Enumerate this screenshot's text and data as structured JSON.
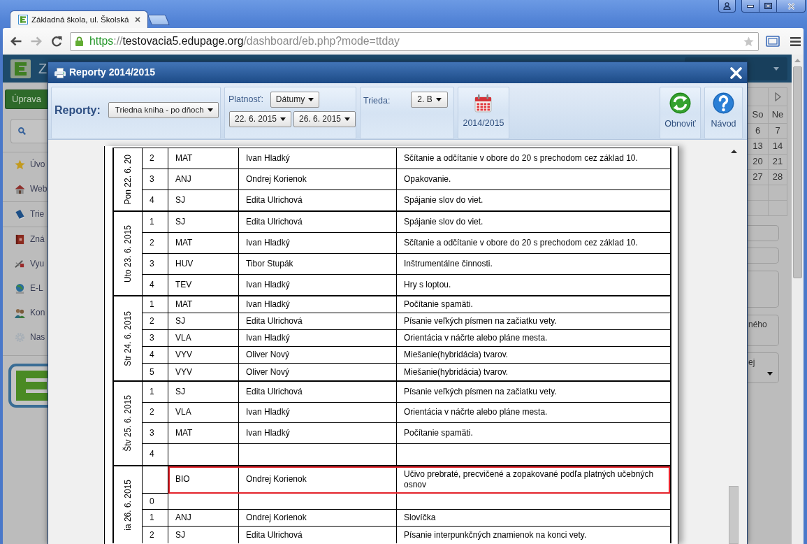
{
  "browser": {
    "tab": {
      "title": "Základná škola, ul. Školská"
    },
    "nav": [
      {
        "kind": "back",
        "disabled": false
      },
      {
        "kind": "forward",
        "disabled": true
      },
      {
        "kind": "reload",
        "disabled": false
      }
    ],
    "url": [
      {
        "text": "https",
        "kind": "scheme"
      },
      {
        "text": "://",
        "kind": "plain"
      },
      {
        "text": "testovacia5.edupage.org",
        "kind": "host"
      },
      {
        "text": "/dashboard/eb.php?mode=ttday",
        "kind": "plain"
      }
    ]
  },
  "background_page": {
    "header": {
      "title": "Z"
    },
    "edit_button": "Úprava",
    "sidebar": [
      {
        "label": "Úvo"
      },
      {
        "label": "Web"
      },
      {
        "label": "Trie"
      },
      {
        "label": "Zná"
      },
      {
        "label": "Vyu"
      },
      {
        "label": "E-L"
      },
      {
        "label": "Kon"
      },
      {
        "label": "Nas"
      }
    ],
    "calendar": {
      "weekdays": [
        "So",
        "Ne"
      ],
      "weeks": [
        [
          "6",
          "7"
        ],
        [
          "13",
          "14"
        ],
        [
          "20",
          "21"
        ],
        [
          "27",
          "28"
        ]
      ]
    },
    "side_panels": [
      {
        "text": "ného",
        "dropdown": false
      },
      {
        "text": "ej",
        "dropdown": true
      }
    ]
  },
  "dialog": {
    "title": "Reporty 2014/2015",
    "report": {
      "label": "Reporty:",
      "value": "Triedna kniha - po dňoch"
    },
    "validity": {
      "label": "Platnosť:",
      "mode": "Dátumy",
      "from": "22. 6. 2015",
      "to": "26. 6. 2015"
    },
    "class": {
      "label": "Trieda:",
      "value": "2. B"
    },
    "school_year": "2014/2015",
    "actions": [
      {
        "kind": "refresh",
        "label": "Obnoviť"
      },
      {
        "kind": "help",
        "label": "Návod"
      }
    ]
  },
  "report": {
    "days": [
      {
        "label": "Pon 22. 6. 20",
        "lessons": [
          {
            "number": "2",
            "subject": "MAT",
            "teacher": "Ivan Hladký",
            "topic": "Sčítanie a odčítanie v obore do 20 s prechodom cez základ 10.",
            "highlighted": false
          },
          {
            "number": "3",
            "subject": "ANJ",
            "teacher": "Ondrej Korienok",
            "topic": "Opakovanie.",
            "highlighted": false
          },
          {
            "number": "4",
            "subject": "SJ",
            "teacher": "Edita Ulrichová",
            "topic": "Spájanie slov do viet.",
            "highlighted": false
          }
        ]
      },
      {
        "label": "Uto 23. 6. 2015",
        "lessons": [
          {
            "number": "1",
            "subject": "SJ",
            "teacher": "Edita Ulrichová",
            "topic": "Spájanie slov do viet.",
            "highlighted": false
          },
          {
            "number": "2",
            "subject": "MAT",
            "teacher": "Ivan Hladký",
            "topic": "Sčítanie a odčítanie v obore do 20 s prechodom cez základ 10.",
            "highlighted": false
          },
          {
            "number": "3",
            "subject": "HUV",
            "teacher": "Tibor Stupák",
            "topic": "Inštrumentálne činnosti.",
            "highlighted": false
          },
          {
            "number": "4",
            "subject": "TEV",
            "teacher": "Ivan Hladký",
            "topic": "Hry s loptou.",
            "highlighted": false
          }
        ]
      },
      {
        "label": "Str 24. 6. 2015",
        "lessons": [
          {
            "number": "1",
            "subject": "MAT",
            "teacher": "Ivan Hladký",
            "topic": "Počítanie spamäti.",
            "highlighted": false
          },
          {
            "number": "2",
            "subject": "SJ",
            "teacher": "Edita Ulrichová",
            "topic": "Písanie veľkých písmen na začiatku vety.",
            "highlighted": false
          },
          {
            "number": "3",
            "subject": "VLA",
            "teacher": "Ivan Hladký",
            "topic": "Orientácia v náčrte alebo pláne mesta.",
            "highlighted": false
          },
          {
            "number": "4",
            "subject": "VYV",
            "teacher": "Oliver Nový",
            "topic": "Miešanie(hybridácia) tvarov.",
            "highlighted": false
          },
          {
            "number": "5",
            "subject": "VYV",
            "teacher": "Oliver Nový",
            "topic": "Miešanie(hybridácia) tvarov.",
            "highlighted": false
          }
        ]
      },
      {
        "label": "Štv 25. 6. 2015",
        "lessons": [
          {
            "number": "1",
            "subject": "SJ",
            "teacher": "Edita Ulrichová",
            "topic": "Písanie veľkých písmen na začiatku vety.",
            "highlighted": false
          },
          {
            "number": "2",
            "subject": "VLA",
            "teacher": "Ivan Hladký",
            "topic": "Orientácia v náčrte alebo pláne mesta.",
            "highlighted": false
          },
          {
            "number": "3",
            "subject": "MAT",
            "teacher": "Ivan Hladký",
            "topic": "Počítanie spamäti.",
            "highlighted": false
          },
          {
            "number": "4",
            "highlighted": false
          }
        ]
      },
      {
        "label": "ia 26. 6. 2015",
        "lessons": [
          {
            "subject": "BIO",
            "teacher": "Ondrej Korienok",
            "topic": "Učivo prebraté, precvičené a zopakované podľa platných učebných osnov",
            "highlighted": true
          },
          {
            "number": "0",
            "highlighted": false
          },
          {
            "number": "1",
            "subject": "ANJ",
            "teacher": "Ondrej Korienok",
            "topic": "Slovíčka",
            "highlighted": false
          },
          {
            "number": "2",
            "subject": "SJ",
            "teacher": "Edita Ulrichová",
            "topic": "Písanie interpunkčných znamienok na konci vety.",
            "highlighted": false
          }
        ]
      }
    ]
  }
}
